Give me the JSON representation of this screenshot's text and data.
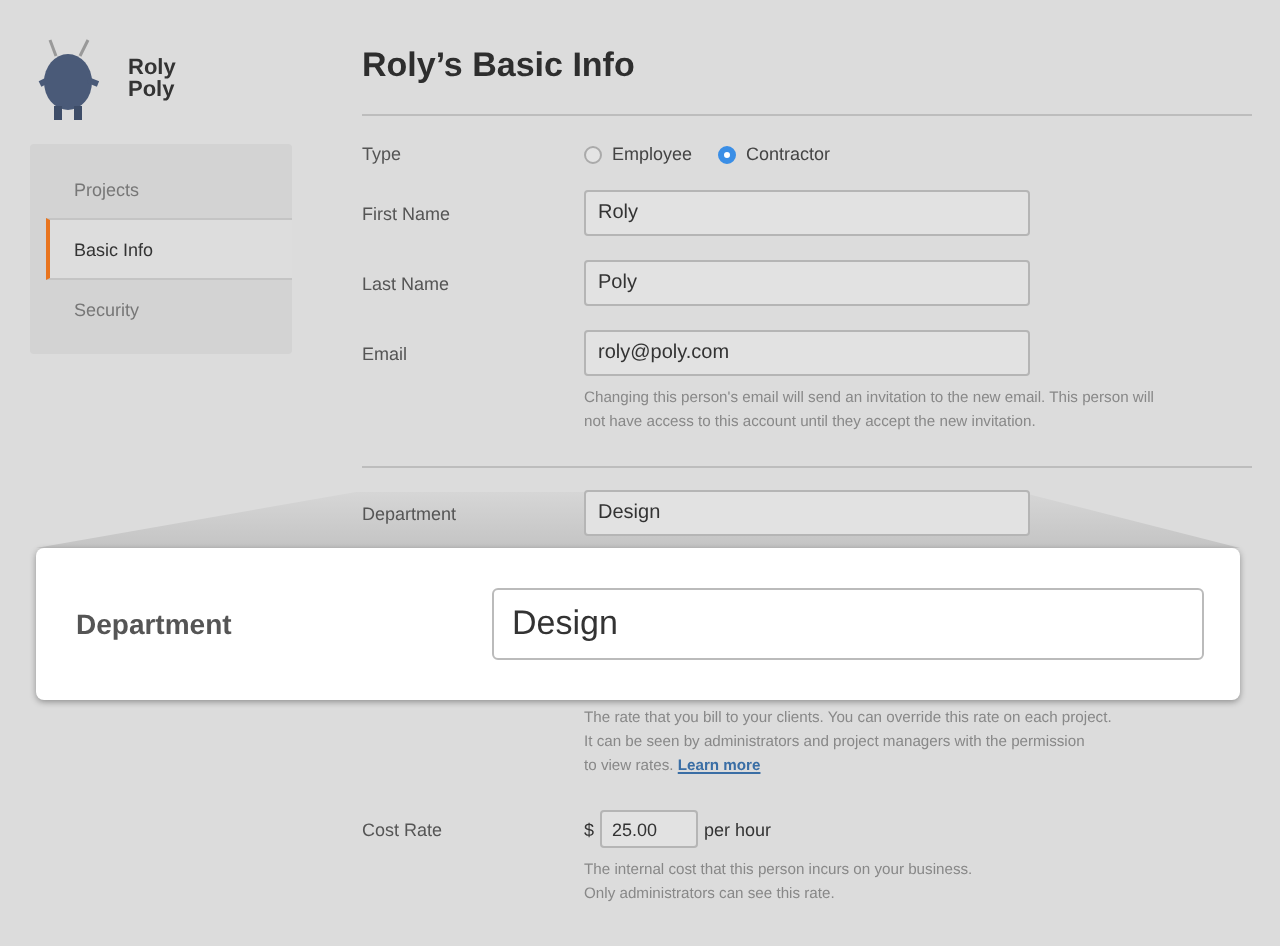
{
  "user": {
    "first_name": "Roly",
    "last_name": "Poly"
  },
  "nav": [
    {
      "label": "Projects",
      "selected": false
    },
    {
      "label": "Basic Info",
      "selected": true
    },
    {
      "label": "Security",
      "selected": false
    }
  ],
  "title": "Roly’s Basic Info",
  "type_field": {
    "label": "Type",
    "options": [
      {
        "label": "Employee",
        "selected": false
      },
      {
        "label": "Contractor",
        "selected": true
      }
    ]
  },
  "fields": [
    {
      "label": "First Name",
      "value": "Roly"
    },
    {
      "label": "Last Name",
      "value": "Poly"
    },
    {
      "label": "Email",
      "value": "roly@poly.com",
      "help": [
        "Changing this person's email will send an invitation to the new email. This person will",
        "not have access to this account until they accept the new invitation."
      ]
    }
  ],
  "department": {
    "label": "Department",
    "value": "Design"
  },
  "bill_rate_help": {
    "lines": [
      "The rate that you bill to your clients. You can override this rate on each project.",
      "It can be seen by administrators and project managers with the permission",
      "to view rates."
    ],
    "link": "Learn more"
  },
  "cost_rate": {
    "label": "Cost Rate",
    "currency": "$",
    "value": "25.00",
    "unit": "per hour",
    "help": [
      "The internal cost that this person incurs on your business.",
      "Only administrators can see this rate."
    ]
  },
  "zoom_callout": {
    "label": "Department",
    "value": "Design"
  }
}
